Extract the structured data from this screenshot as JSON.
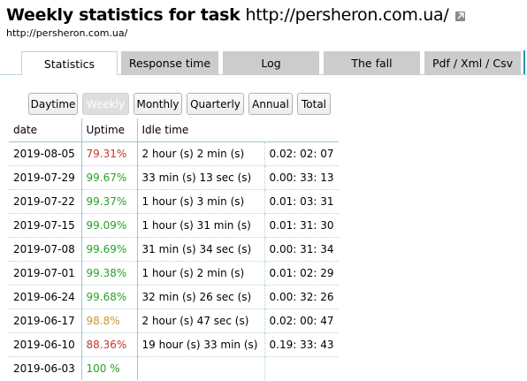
{
  "header": {
    "title_bold": "Weekly statistics for task",
    "title_url": "http://persheron.com.ua/",
    "subtitle": "http://persheron.com.ua/"
  },
  "tabs": [
    {
      "label": "Statistics",
      "active": true
    },
    {
      "label": "Response time",
      "active": false
    },
    {
      "label": "Log",
      "active": false
    },
    {
      "label": "The fall",
      "active": false
    },
    {
      "label": "Pdf / Xml / Csv",
      "active": false
    }
  ],
  "periods": [
    {
      "label": "Daytime",
      "active": false
    },
    {
      "label": "Weekly",
      "active": true
    },
    {
      "label": "Monthly",
      "active": false
    },
    {
      "label": "Quarterly",
      "active": false
    },
    {
      "label": "Annual",
      "active": false
    },
    {
      "label": "Total",
      "active": false
    }
  ],
  "table": {
    "headers": [
      "date",
      "Uptime",
      "Idle time"
    ],
    "rows": [
      {
        "date": "2019-08-05",
        "uptime": "79.31%",
        "uptime_color": "#c0392b",
        "idle": "2 hour (s) 2 min (s)",
        "clock": "0.02: 02: 07"
      },
      {
        "date": "2019-07-29",
        "uptime": "99.67%",
        "uptime_color": "#27a127",
        "idle": "33 min (s) 13 sec (s)",
        "clock": "0.00: 33: 13"
      },
      {
        "date": "2019-07-22",
        "uptime": "99.37%",
        "uptime_color": "#27a127",
        "idle": "1 hour (s) 3 min (s)",
        "clock": "0.01: 03: 31"
      },
      {
        "date": "2019-07-15",
        "uptime": "99.09%",
        "uptime_color": "#27a127",
        "idle": "1 hour (s) 31 min (s)",
        "clock": "0.01: 31: 30"
      },
      {
        "date": "2019-07-08",
        "uptime": "99.69%",
        "uptime_color": "#27a127",
        "idle": "31 min (s) 34 sec (s)",
        "clock": "0.00: 31: 34"
      },
      {
        "date": "2019-07-01",
        "uptime": "99.38%",
        "uptime_color": "#27a127",
        "idle": "1 hour (s) 2 min (s)",
        "clock": "0.01: 02: 29"
      },
      {
        "date": "2019-06-24",
        "uptime": "99.68%",
        "uptime_color": "#27a127",
        "idle": "32 min (s) 26 sec (s)",
        "clock": "0.00: 32: 26"
      },
      {
        "date": "2019-06-17",
        "uptime": "98.8%",
        "uptime_color": "#c8962e",
        "idle": "2 hour (s) 47 sec (s)",
        "clock": "0.02: 00: 47"
      },
      {
        "date": "2019-06-10",
        "uptime": "88.36%",
        "uptime_color": "#c0392b",
        "idle": "19 hour (s) 33 min (s)",
        "clock": "0.19: 33: 43"
      },
      {
        "date": "2019-06-03",
        "uptime": "100 %",
        "uptime_color": "#27a127",
        "idle": "",
        "clock": ""
      }
    ]
  },
  "icons": {
    "external_link": "external-link-icon"
  }
}
